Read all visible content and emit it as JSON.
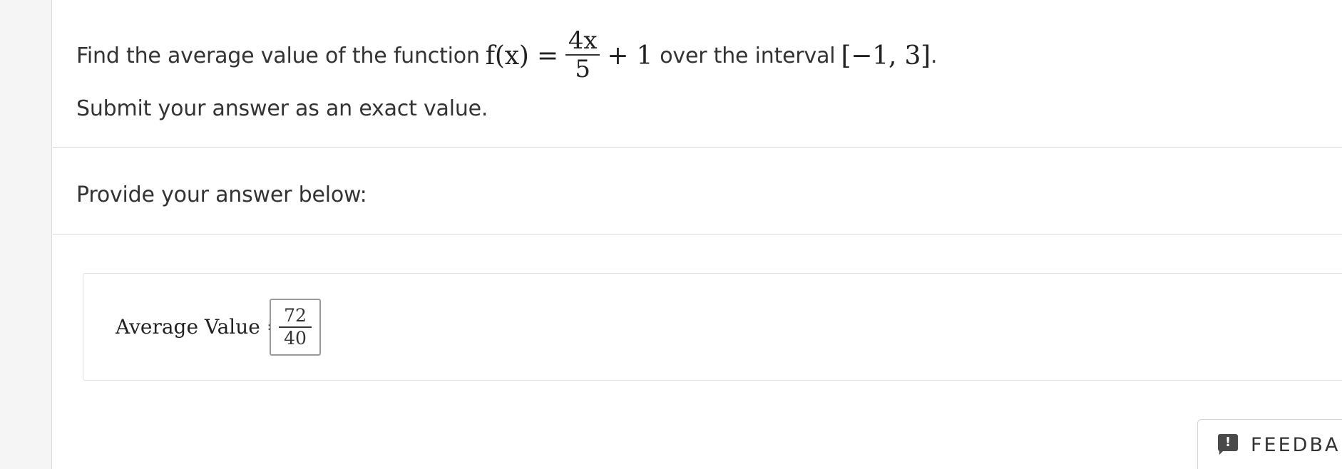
{
  "question": {
    "lead_text": "Find the average value of the function",
    "function_lhs": "f(x) =",
    "fraction_numerator": "4x",
    "fraction_denominator": "5",
    "function_tail": "+ 1",
    "mid_text": "over the interval",
    "interval": "[−1, 3]",
    "end_text": ".",
    "instruction": "Submit your answer as an exact value."
  },
  "answer_prompt": "Provide your answer below:",
  "answer": {
    "label": "Average Value =",
    "numerator": "72",
    "denominator": "40"
  },
  "feedback": {
    "label": "FEEDBA",
    "icon": "feedback-exclamation-icon"
  }
}
